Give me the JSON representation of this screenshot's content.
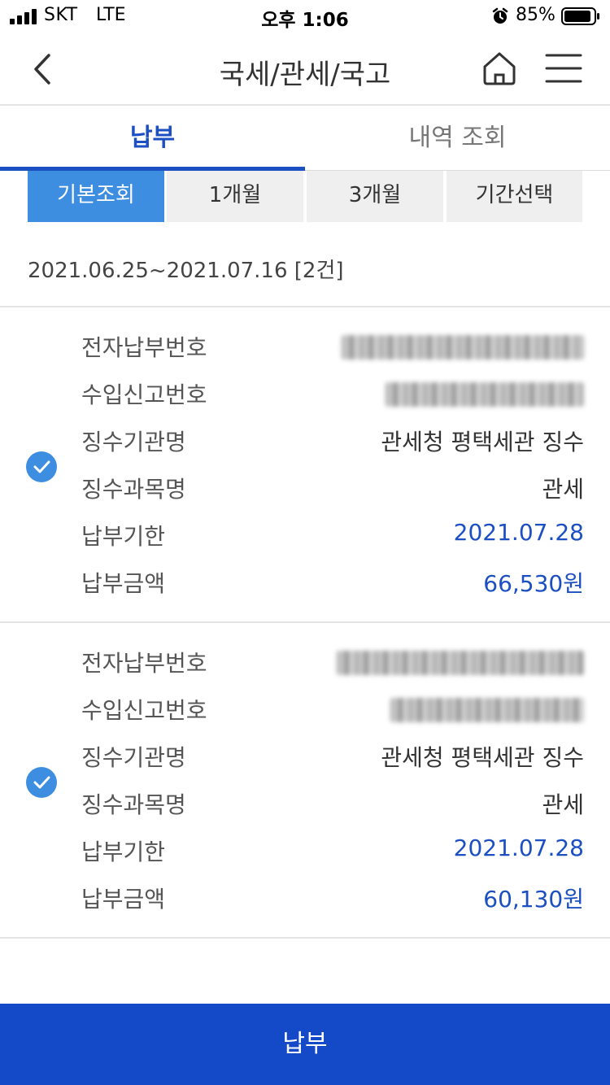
{
  "status_bar": {
    "carrier": "SKT",
    "network": "LTE",
    "time": "오후 1:06",
    "battery": "85%",
    "icons": [
      "signal-icon",
      "alarm-icon",
      "battery-icon"
    ]
  },
  "header": {
    "title": "국세/관세/국고",
    "icons": [
      "back-icon",
      "home-icon",
      "menu-icon"
    ]
  },
  "tabs": [
    {
      "label": "납부",
      "active": true
    },
    {
      "label": "내역 조회",
      "active": false
    }
  ],
  "filters": [
    {
      "label": "기본조회",
      "active": true
    },
    {
      "label": "1개월",
      "active": false
    },
    {
      "label": "3개월",
      "active": false
    },
    {
      "label": "기간선택",
      "active": false
    }
  ],
  "date_range": "2021.06.25~2021.07.16 [2건]",
  "items": [
    {
      "checked": true,
      "rows": [
        {
          "label": "전자납부번호",
          "value": "",
          "masked": true
        },
        {
          "label": "수입신고번호",
          "value": "",
          "masked": true
        },
        {
          "label": "징수기관명",
          "value": "관세청 평택세관 징수"
        },
        {
          "label": "징수과목명",
          "value": "관세"
        },
        {
          "label": "납부기한",
          "value": "2021.07.28"
        },
        {
          "label": "납부금액",
          "value": "66,530원"
        }
      ]
    },
    {
      "checked": true,
      "rows": [
        {
          "label": "전자납부번호",
          "value": "",
          "masked": true
        },
        {
          "label": "수입신고번호",
          "value": "",
          "masked": true
        },
        {
          "label": "징수기관명",
          "value": "관세청 평택세관 징수"
        },
        {
          "label": "징수과목명",
          "value": "관세"
        },
        {
          "label": "납부기한",
          "value": "2021.07.28"
        },
        {
          "label": "납부금액",
          "value": "60,130원"
        }
      ]
    }
  ],
  "pay_button": "납부",
  "colors": {
    "primary": "#1b4fc2",
    "button": "#1449c7",
    "filter_active": "#3d8ee0",
    "check": "#3d8ee0"
  }
}
